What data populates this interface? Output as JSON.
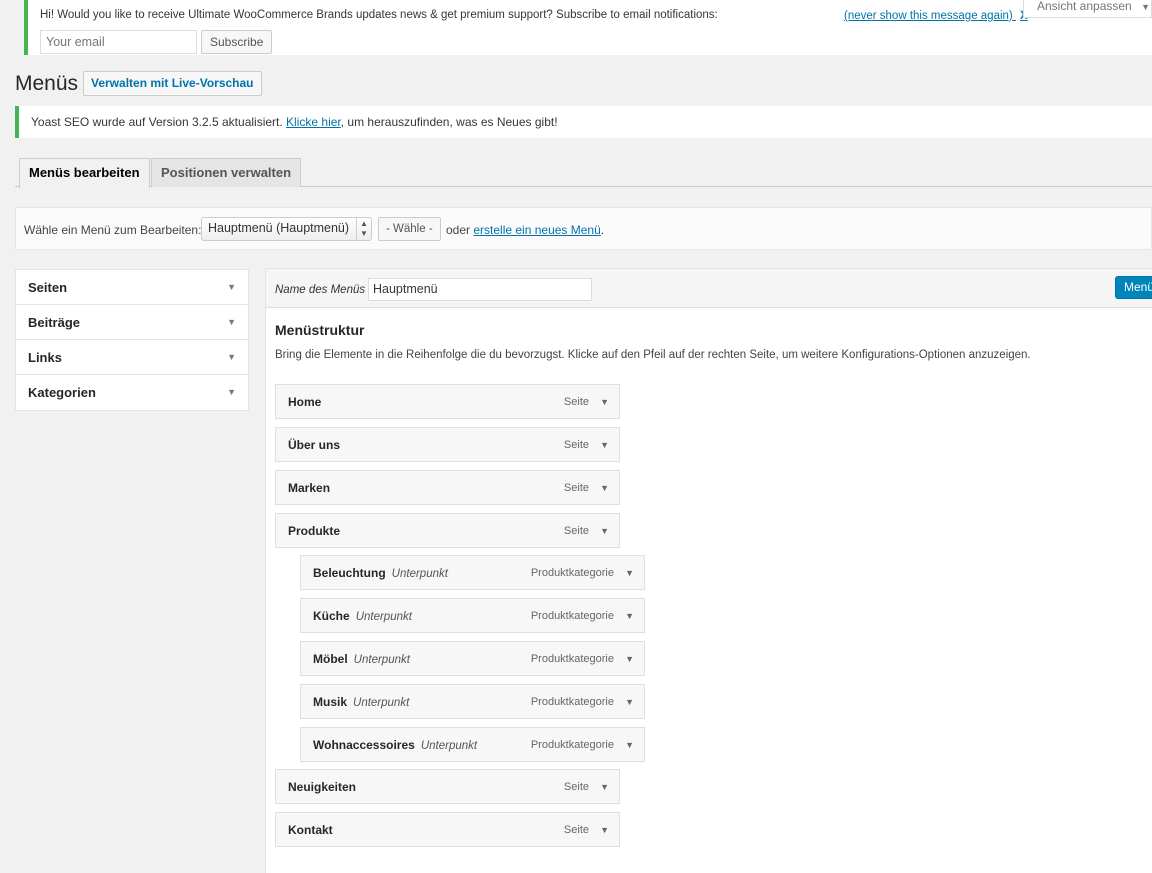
{
  "subscribe_notice": {
    "message": "Hi! Would you like to receive Ultimate WooCommerce Brands updates news & get premium support? Subscribe to email notifications:",
    "email_placeholder": "Your email",
    "subscribe_label": "Subscribe",
    "never_show_label": "(never show this message again)",
    "dismiss_label": "X"
  },
  "screen_options": {
    "label": "Ansicht anpassen"
  },
  "page": {
    "title": "Menüs",
    "live_preview_label": "Verwalten mit Live-Vorschau"
  },
  "yoast_notice": {
    "text_before": "Yoast SEO wurde auf Version 3.2.5 aktualisiert. ",
    "link_text": "Klicke hier",
    "text_after": ", um herauszufinden, was es Neues gibt!"
  },
  "tabs": [
    {
      "label": "Menüs bearbeiten",
      "active": true
    },
    {
      "label": "Positionen verwalten",
      "active": false
    }
  ],
  "select_menu": {
    "label": "Wähle ein Menü zum Bearbeiten:",
    "selected": "Hauptmenü (Hauptmenü)",
    "choose_label": "- Wähle -",
    "or_text": "oder ",
    "create_link": "erstelle ein neues Menü",
    "period": "."
  },
  "accordion": [
    {
      "label": "Seiten"
    },
    {
      "label": "Beiträge"
    },
    {
      "label": "Links"
    },
    {
      "label": "Kategorien"
    }
  ],
  "menu_editor": {
    "name_label": "Name des Menüs",
    "name_value": "Hauptmenü",
    "save_label": "Menü",
    "structure_title": "Menüstruktur",
    "structure_desc": "Bring die Elemente in die Reihenfolge die du bevorzugst. Klicke auf den Pfeil auf der rechten Seite, um weitere Konfigurations-Optionen anzuzeigen."
  },
  "menu_items": [
    {
      "title": "Home",
      "sub": "",
      "type": "Seite",
      "depth": 0
    },
    {
      "title": "Über uns",
      "sub": "",
      "type": "Seite",
      "depth": 0
    },
    {
      "title": "Marken",
      "sub": "",
      "type": "Seite",
      "depth": 0
    },
    {
      "title": "Produkte",
      "sub": "",
      "type": "Seite",
      "depth": 0
    },
    {
      "title": "Beleuchtung",
      "sub": "Unterpunkt",
      "type": "Produktkategorie",
      "depth": 1
    },
    {
      "title": "Küche",
      "sub": "Unterpunkt",
      "type": "Produktkategorie",
      "depth": 1
    },
    {
      "title": "Möbel",
      "sub": "Unterpunkt",
      "type": "Produktkategorie",
      "depth": 1
    },
    {
      "title": "Musik",
      "sub": "Unterpunkt",
      "type": "Produktkategorie",
      "depth": 1
    },
    {
      "title": "Wohnaccessoires",
      "sub": "Unterpunkt",
      "type": "Produktkategorie",
      "depth": 1
    },
    {
      "title": "Neuigkeiten",
      "sub": "",
      "type": "Seite",
      "depth": 0
    },
    {
      "title": "Kontakt",
      "sub": "",
      "type": "Seite",
      "depth": 0
    }
  ],
  "colors": {
    "accent": "#0073aa",
    "primary_button": "#0085ba",
    "notice_border": "#46b450"
  }
}
